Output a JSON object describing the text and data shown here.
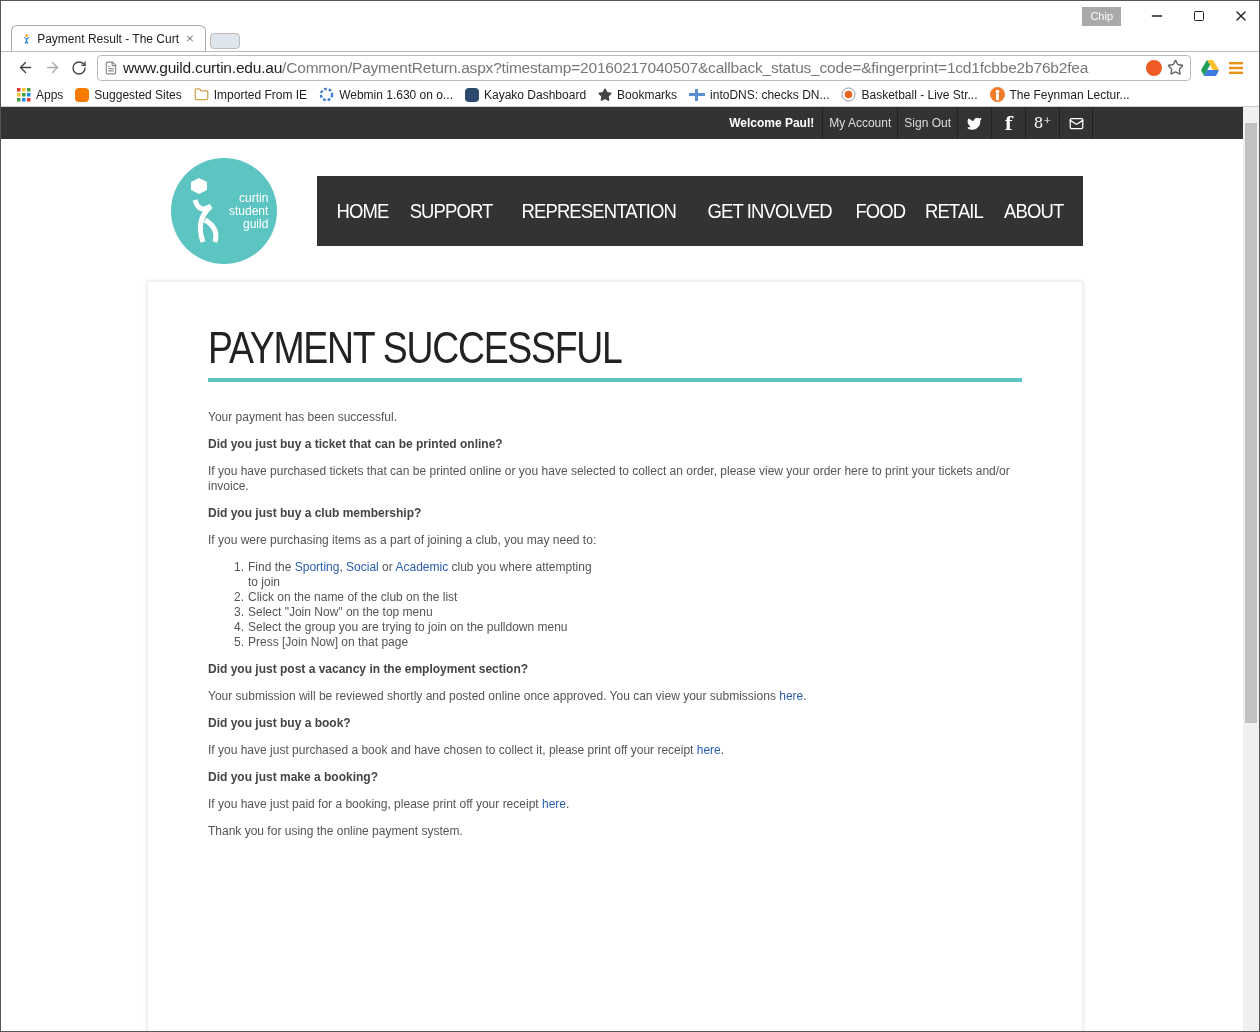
{
  "browser": {
    "tab": {
      "title": "Payment Result - The Curt",
      "selected": true
    },
    "profile": "Chip",
    "url_host": "www.guild.curtin.edu.au",
    "url_path": "/Common/PaymentReturn.aspx?timestamp=20160217040507&callback_status_code=&fingerprint=1cd1fcbbe2b76b2fea",
    "bookmarks": [
      "Apps",
      "Suggested Sites",
      "Imported From IE",
      "Webmin 1.630 on o...",
      "Kayako Dashboard",
      "Bookmarks",
      "intoDNS: checks DN...",
      "Basketball - Live Str...",
      "The Feynman Lectur..."
    ]
  },
  "topbar": {
    "welcome": "Welcome Paul!",
    "links": [
      "My Account",
      "Sign Out"
    ],
    "social": [
      {
        "kind": "twitter"
      },
      {
        "kind": "facebook",
        "text": "f"
      },
      {
        "kind": "gplus",
        "text": "8⁺"
      },
      {
        "kind": "mail"
      }
    ]
  },
  "logo": {
    "lines": [
      "curtin",
      "student",
      "guild"
    ]
  },
  "nav": [
    "HOME",
    "SUPPORT",
    "REPRESENTATION",
    "GET INVOLVED",
    "FOOD",
    "RETAIL",
    "ABOUT"
  ],
  "heading": "PAYMENT SUCCESSFUL",
  "blocks": [
    {
      "kind": "text",
      "parts": [
        {
          "kind": "plain",
          "text": "Your payment has been successful."
        }
      ]
    },
    {
      "kind": "question",
      "text": "Did you just buy a ticket that can be printed online?"
    },
    {
      "kind": "text",
      "parts": [
        {
          "kind": "plain",
          "text": "If you have purchased tickets that can be printed online or you have selected to collect an order, please view your order here to print your tickets and/or invoice."
        }
      ]
    },
    {
      "kind": "question",
      "text": "Did you just buy a club membership?"
    },
    {
      "kind": "text",
      "parts": [
        {
          "kind": "plain",
          "text": "If you were purchasing items as a part of joining a club, you may need to:"
        }
      ]
    },
    {
      "kind": "list",
      "items": [
        {
          "num": "1.",
          "parts": [
            {
              "kind": "plain",
              "text": "Find the "
            },
            {
              "kind": "link",
              "text": "Sporting"
            },
            {
              "kind": "plain",
              "text": ", "
            },
            {
              "kind": "link",
              "text": "Social"
            },
            {
              "kind": "plain",
              "text": " or "
            },
            {
              "kind": "link",
              "text": "Academic"
            },
            {
              "kind": "plain",
              "text": " club you where attempting to join"
            }
          ]
        },
        {
          "num": "2.",
          "parts": [
            {
              "kind": "plain",
              "text": "Click on the name of the club on the list"
            }
          ]
        },
        {
          "num": "3.",
          "parts": [
            {
              "kind": "plain",
              "text": "Select \"Join Now\" on the top menu"
            }
          ]
        },
        {
          "num": "4.",
          "parts": [
            {
              "kind": "plain",
              "text": "Select the group you are trying to join on the pulldown menu"
            }
          ]
        },
        {
          "num": "5.",
          "parts": [
            {
              "kind": "plain",
              "text": "Press [Join Now] on that page"
            }
          ]
        }
      ]
    },
    {
      "kind": "question",
      "text": "Did you just post a vacancy in the employment section?"
    },
    {
      "kind": "text",
      "parts": [
        {
          "kind": "plain",
          "text": "Your submission will be reviewed shortly and posted online once approved. You can view your submissions "
        },
        {
          "kind": "link",
          "text": "here"
        },
        {
          "kind": "plain",
          "text": "."
        }
      ]
    },
    {
      "kind": "question",
      "text": "Did you just buy a book?"
    },
    {
      "kind": "text",
      "parts": [
        {
          "kind": "plain",
          "text": "If you have just purchased a book and have chosen to collect it, please print off your receipt "
        },
        {
          "kind": "link",
          "text": "here"
        },
        {
          "kind": "plain",
          "text": "."
        }
      ]
    },
    {
      "kind": "question",
      "text": "Did you just make a booking?"
    },
    {
      "kind": "text",
      "parts": [
        {
          "kind": "plain",
          "text": "If you have just paid for a booking, please print off your receipt "
        },
        {
          "kind": "link",
          "text": "here"
        },
        {
          "kind": "plain",
          "text": "."
        }
      ]
    },
    {
      "kind": "text",
      "parts": [
        {
          "kind": "plain",
          "text": "Thank you for using the online payment system."
        }
      ]
    }
  ]
}
